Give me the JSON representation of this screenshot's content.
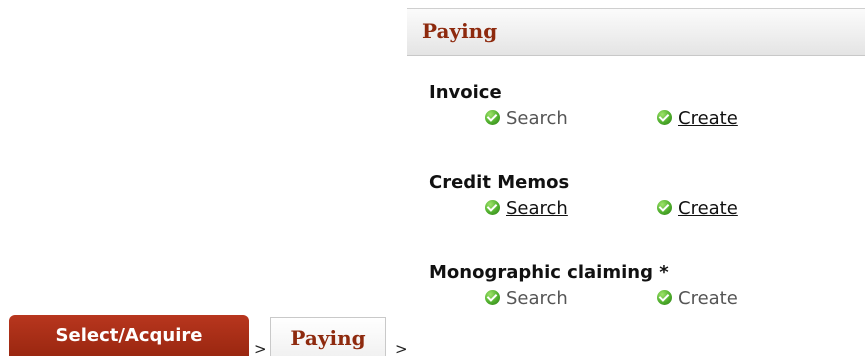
{
  "panel": {
    "title": "Paying"
  },
  "sections": [
    {
      "title": "Invoice",
      "search": "Search",
      "create": "Create"
    },
    {
      "title": "Credit Memos",
      "search": "Search",
      "create": "Create"
    },
    {
      "title": "Monographic claiming *",
      "search": "Search",
      "create": "Create"
    }
  ],
  "breadcrumb": {
    "active_tab": "Select/Acquire",
    "separator": ">",
    "current_tab": "Paying"
  },
  "icons": {
    "action_icon": "green-check-circle-icon"
  },
  "colors": {
    "accent": "#9e2a12",
    "title_red": "#8e2a0e",
    "icon_green": "#4fae2c"
  }
}
